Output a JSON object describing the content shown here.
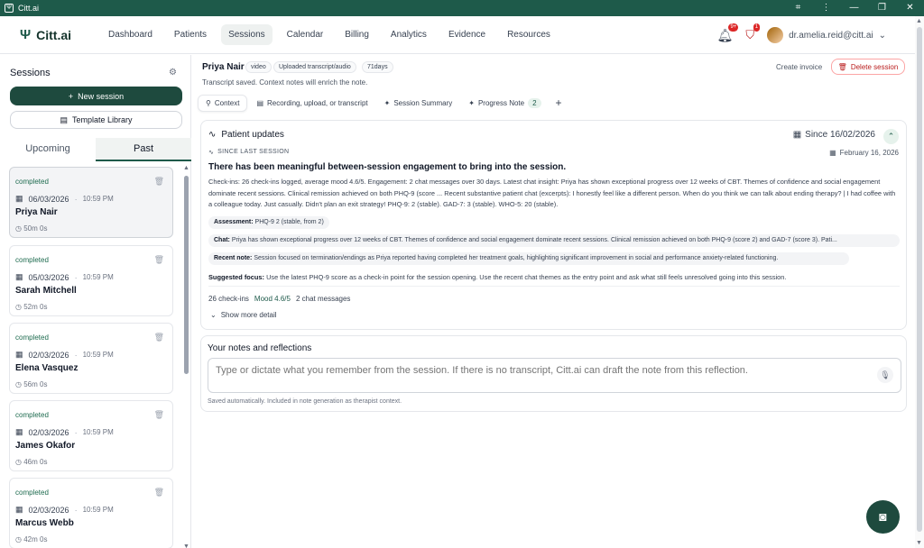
{
  "window": {
    "title": "Citt.ai",
    "controls": [
      "⌗",
      "⋮",
      "—",
      "❐",
      "✕"
    ]
  },
  "brand": {
    "name": "Citt.ai",
    "logo": "Ψ"
  },
  "nav": [
    "Dashboard",
    "Patients",
    "Sessions",
    "Calendar",
    "Billing",
    "Analytics",
    "Evidence",
    "Resources"
  ],
  "header": {
    "notif_badge": "9+",
    "alert_badge": "1",
    "user_email": "dr.amelia.reid@citt.ai"
  },
  "sidebar": {
    "title": "Sessions",
    "new_session": "New session",
    "template_library": "Template Library",
    "tabs": [
      "Upcoming",
      "Past"
    ],
    "sessions": [
      {
        "status": "completed",
        "date": "06/03/2026",
        "time": "10:59 PM",
        "name": "Priya Nair",
        "duration": "50m 0s"
      },
      {
        "status": "completed",
        "date": "05/03/2026",
        "time": "10:59 PM",
        "name": "Sarah Mitchell",
        "duration": "52m 0s"
      },
      {
        "status": "completed",
        "date": "02/03/2026",
        "time": "10:59 PM",
        "name": "Elena Vasquez",
        "duration": "56m 0s"
      },
      {
        "status": "completed",
        "date": "02/03/2026",
        "time": "10:59 PM",
        "name": "James Okafor",
        "duration": "46m 0s"
      },
      {
        "status": "completed",
        "date": "02/03/2026",
        "time": "10:59 PM",
        "name": "Marcus Webb",
        "duration": "42m 0s"
      }
    ]
  },
  "session": {
    "patient": "Priya Nair",
    "pills": [
      "video",
      "Uploaded transcript/audio",
      "71days"
    ],
    "subtitle": "Transcript saved. Context notes will enrich the note.",
    "create_invoice": "Create invoice",
    "delete": "Delete session",
    "tabs": [
      "Context",
      "Recording, upload, or transcript",
      "Session Summary",
      "Progress Note"
    ],
    "progress_count": "2"
  },
  "updates": {
    "title": "Patient updates",
    "since": "Since 16/02/2026",
    "since_label": "SINCE LAST SESSION",
    "date": "February 16, 2026",
    "headline": "There has been meaningful between-session engagement to bring into the session.",
    "body": "Check-ins: 26 check-ins logged, average mood 4.6/5. Engagement: 2 chat messages over 30 days. Latest chat insight: Priya has shown exceptional progress over 12 weeks of CBT. Themes of confidence and social engagement dominate recent sessions. Clinical remission achieved on both PHQ-9 (score ... Recent substantive patient chat (excerpts): I honestly feel like a different person. When do you think we can talk about ending therapy? | I had coffee with a colleague today. Just casually. Didn't plan an exit strategy! PHQ-9: 2 (stable). GAD-7: 3 (stable). WHO-5: 20 (stable).",
    "chips": [
      {
        "label": "Assessment:",
        "text": "PHQ-9 2 (stable, from 2)"
      },
      {
        "label": "Chat:",
        "text": "Priya has shown exceptional progress over 12 weeks of CBT. Themes of confidence and social engagement dominate recent sessions. Clinical remission achieved on both PHQ-9 (score 2) and GAD-7 (score 3). Pati..."
      },
      {
        "label": "Recent note:",
        "text": "Session focused on termination/endings as Priya reported having completed her treatment goals, highlighting significant improvement in social and performance anxiety-related functioning."
      }
    ],
    "focus_label": "Suggested focus:",
    "focus_text": "Use the latest PHQ-9 score as a check-in point for the session opening. Use the recent chat themes as the entry point and ask what still feels unresolved going into this session.",
    "stats": {
      "checkins": "26 check-ins",
      "mood": "Mood 4.6/5",
      "chats": "2 chat messages"
    },
    "more": "Show more detail"
  },
  "notes": {
    "title": "Your notes and reflections",
    "placeholder": "Type or dictate what you remember from the session. If there is no transcript, Citt.ai can draft the note from this reflection.",
    "hint": "Saved automatically. Included in note generation as therapist context."
  },
  "colors": {
    "primary": "#1e4a3e",
    "accent": "#1e5a4a",
    "danger": "#b91c1c"
  }
}
